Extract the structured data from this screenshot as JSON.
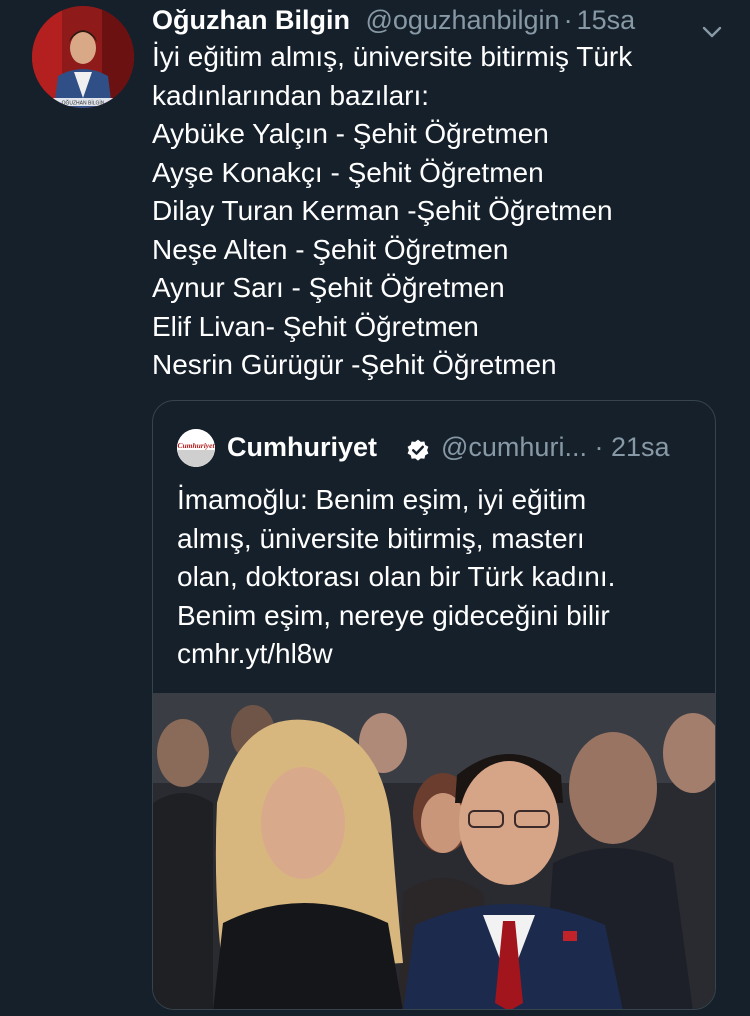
{
  "tweet": {
    "author_name": "Oğuzhan Bilgin",
    "handle": "@oguzhanbilgin",
    "separator": "·",
    "time": "15sa",
    "avatar_caption": "OĞUZHAN BİLGİN",
    "lines": [
      "İyi eğitim almış, üniversite bitirmiş Türk",
      "kadınlarından bazıları:",
      "Aybüke Yalçın - Şehit Öğretmen",
      "Ayşe Konakçı - Şehit Öğretmen",
      "Dilay Turan Kerman -Şehit Öğretmen",
      "Neşe Alten - Şehit Öğretmen",
      "Aynur Sarı - Şehit Öğretmen",
      "Elif Livan- Şehit Öğretmen",
      "Nesrin Gürügür -Şehit Öğretmen"
    ]
  },
  "quoted": {
    "author_name": "Cumhuriyet",
    "handle": "@cumhuri...",
    "separator": "·",
    "time": "21sa",
    "logo_text": "Cumhuriyet",
    "lines": [
      "İmamoğlu: Benim eşim, iyi eğitim",
      "almış, üniversite bitirmiş, masterı",
      "olan, doktorası olan bir Türk kadını.",
      "Benim eşim, nereye gideceğini bilir",
      "cmhr.yt/hl8w"
    ]
  },
  "icons": {
    "more": "chevron-down-icon",
    "verified": "verified-badge-icon"
  },
  "colors": {
    "background": "#15202b",
    "text": "#ffffff",
    "secondary_text": "#8899a6",
    "border": "#38444d"
  }
}
